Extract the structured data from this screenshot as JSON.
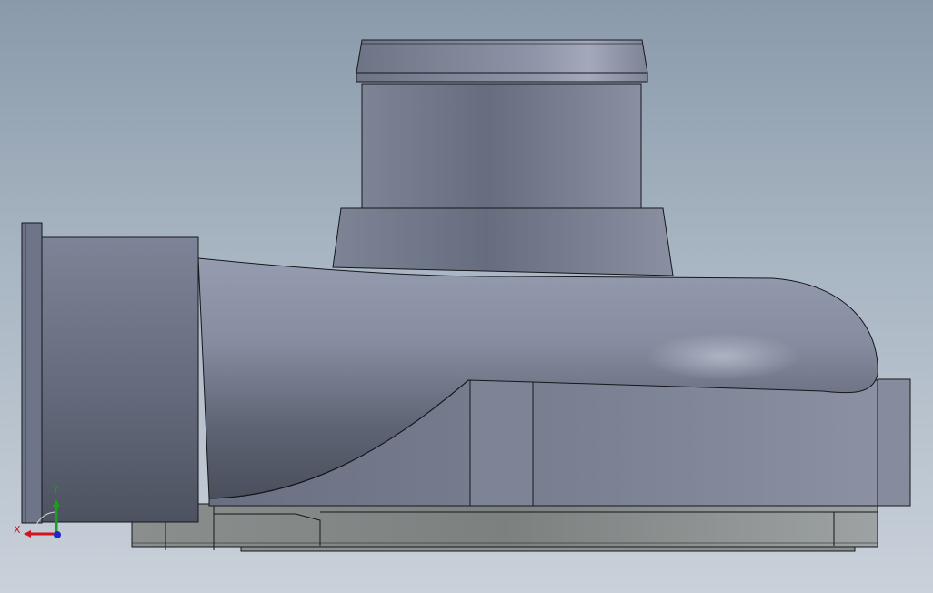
{
  "viewport": {
    "background_top": "#8a9aab",
    "background_bottom": "#c9d1da",
    "part_color": "#7b8296",
    "edge_color": "#15171c"
  },
  "triad": {
    "x_label": "X",
    "y_label": "Y",
    "x_color": "#d2141e",
    "y_color": "#1aa01a",
    "z_color": "#1e28c8"
  }
}
